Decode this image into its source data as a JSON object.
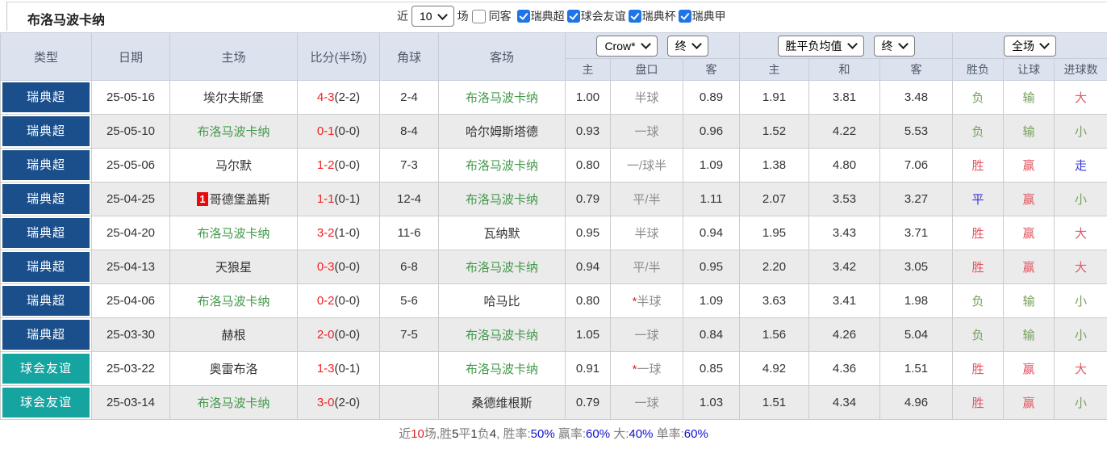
{
  "header": {
    "team_title": "布洛马波卡纳",
    "recent_label": "近",
    "recent_count": "10",
    "matches_label": "场",
    "same_away_label": "同客",
    "leagues": [
      {
        "label": "瑞典超",
        "checked": true
      },
      {
        "label": "球会友谊",
        "checked": true
      },
      {
        "label": "瑞典杯",
        "checked": true
      },
      {
        "label": "瑞典甲",
        "checked": true
      }
    ]
  },
  "table": {
    "main_headers": [
      "类型",
      "日期",
      "主场",
      "比分(半场)",
      "角球",
      "客场"
    ],
    "dropdowns": {
      "odds_company": "Crow*",
      "odds_time": "终",
      "avg_type": "胜平负均值",
      "avg_time": "终",
      "scope": "全场"
    },
    "sub_headers": [
      "主",
      "盘口",
      "客",
      "主",
      "和",
      "客",
      "胜负",
      "让球",
      "进球数"
    ],
    "league_colors": {
      "瑞典超": "#1a4f8c",
      "球会友谊": "#16a4a0"
    },
    "rows": [
      {
        "league": "瑞典超",
        "date": "25-05-16",
        "home": "埃尔夫斯堡",
        "home_badge": "",
        "home_is_target": false,
        "score": "4-3",
        "half": "(2-2)",
        "corner": "2-4",
        "away": "布洛马波卡纳",
        "away_is_target": true,
        "odds_home": "1.00",
        "handicap_star": "",
        "handicap": "半球",
        "odds_away": "0.89",
        "avg_home": "1.91",
        "avg_draw": "3.81",
        "avg_away": "3.48",
        "result": "负",
        "result_color": "green",
        "handicap_result": "输",
        "handicap_result_color": "green",
        "goals": "大",
        "goals_color": "red"
      },
      {
        "league": "瑞典超",
        "date": "25-05-10",
        "home": "布洛马波卡纳",
        "home_badge": "",
        "home_is_target": true,
        "score": "0-1",
        "half": "(0-0)",
        "corner": "8-4",
        "away": "哈尔姆斯塔德",
        "away_is_target": false,
        "odds_home": "0.93",
        "handicap_star": "",
        "handicap": "一球",
        "odds_away": "0.96",
        "avg_home": "1.52",
        "avg_draw": "4.22",
        "avg_away": "5.53",
        "result": "负",
        "result_color": "green",
        "handicap_result": "输",
        "handicap_result_color": "green",
        "goals": "小",
        "goals_color": "green"
      },
      {
        "league": "瑞典超",
        "date": "25-05-06",
        "home": "马尔默",
        "home_badge": "",
        "home_is_target": false,
        "score": "1-2",
        "half": "(0-0)",
        "corner": "7-3",
        "away": "布洛马波卡纳",
        "away_is_target": true,
        "odds_home": "0.80",
        "handicap_star": "",
        "handicap": "一/球半",
        "odds_away": "1.09",
        "avg_home": "1.38",
        "avg_draw": "4.80",
        "avg_away": "7.06",
        "result": "胜",
        "result_color": "red",
        "handicap_result": "赢",
        "handicap_result_color": "red",
        "goals": "走",
        "goals_color": "blue"
      },
      {
        "league": "瑞典超",
        "date": "25-04-25",
        "home": "哥德堡盖斯",
        "home_badge": "1",
        "home_is_target": false,
        "score": "1-1",
        "half": "(0-1)",
        "corner": "12-4",
        "away": "布洛马波卡纳",
        "away_is_target": true,
        "odds_home": "0.79",
        "handicap_star": "",
        "handicap": "平/半",
        "odds_away": "1.11",
        "avg_home": "2.07",
        "avg_draw": "3.53",
        "avg_away": "3.27",
        "result": "平",
        "result_color": "blue",
        "handicap_result": "赢",
        "handicap_result_color": "red",
        "goals": "小",
        "goals_color": "green"
      },
      {
        "league": "瑞典超",
        "date": "25-04-20",
        "home": "布洛马波卡纳",
        "home_badge": "",
        "home_is_target": true,
        "score": "3-2",
        "half": "(1-0)",
        "corner": "11-6",
        "away": "瓦纳默",
        "away_is_target": false,
        "odds_home": "0.95",
        "handicap_star": "",
        "handicap": "半球",
        "odds_away": "0.94",
        "avg_home": "1.95",
        "avg_draw": "3.43",
        "avg_away": "3.71",
        "result": "胜",
        "result_color": "red",
        "handicap_result": "赢",
        "handicap_result_color": "red",
        "goals": "大",
        "goals_color": "red"
      },
      {
        "league": "瑞典超",
        "date": "25-04-13",
        "home": "天狼星",
        "home_badge": "",
        "home_is_target": false,
        "score": "0-3",
        "half": "(0-0)",
        "corner": "6-8",
        "away": "布洛马波卡纳",
        "away_is_target": true,
        "odds_home": "0.94",
        "handicap_star": "",
        "handicap": "平/半",
        "odds_away": "0.95",
        "avg_home": "2.20",
        "avg_draw": "3.42",
        "avg_away": "3.05",
        "result": "胜",
        "result_color": "red",
        "handicap_result": "赢",
        "handicap_result_color": "red",
        "goals": "大",
        "goals_color": "red"
      },
      {
        "league": "瑞典超",
        "date": "25-04-06",
        "home": "布洛马波卡纳",
        "home_badge": "",
        "home_is_target": true,
        "score": "0-2",
        "half": "(0-0)",
        "corner": "5-6",
        "away": "哈马比",
        "away_is_target": false,
        "odds_home": "0.80",
        "handicap_star": "*",
        "handicap": "半球",
        "odds_away": "1.09",
        "avg_home": "3.63",
        "avg_draw": "3.41",
        "avg_away": "1.98",
        "result": "负",
        "result_color": "green",
        "handicap_result": "输",
        "handicap_result_color": "green",
        "goals": "小",
        "goals_color": "green"
      },
      {
        "league": "瑞典超",
        "date": "25-03-30",
        "home": "赫根",
        "home_badge": "",
        "home_is_target": false,
        "score": "2-0",
        "half": "(0-0)",
        "corner": "7-5",
        "away": "布洛马波卡纳",
        "away_is_target": true,
        "odds_home": "1.05",
        "handicap_star": "",
        "handicap": "一球",
        "odds_away": "0.84",
        "avg_home": "1.56",
        "avg_draw": "4.26",
        "avg_away": "5.04",
        "result": "负",
        "result_color": "green",
        "handicap_result": "输",
        "handicap_result_color": "green",
        "goals": "小",
        "goals_color": "green"
      },
      {
        "league": "球会友谊",
        "date": "25-03-22",
        "home": "奥雷布洛",
        "home_badge": "",
        "home_is_target": false,
        "score": "1-3",
        "half": "(0-1)",
        "corner": "",
        "away": "布洛马波卡纳",
        "away_is_target": true,
        "odds_home": "0.91",
        "handicap_star": "*",
        "handicap": "一球",
        "odds_away": "0.85",
        "avg_home": "4.92",
        "avg_draw": "4.36",
        "avg_away": "1.51",
        "result": "胜",
        "result_color": "red",
        "handicap_result": "赢",
        "handicap_result_color": "red",
        "goals": "大",
        "goals_color": "red"
      },
      {
        "league": "球会友谊",
        "date": "25-03-14",
        "home": "布洛马波卡纳",
        "home_badge": "",
        "home_is_target": true,
        "score": "3-0",
        "half": "(2-0)",
        "corner": "",
        "away": "桑德维根斯",
        "away_is_target": false,
        "odds_home": "0.79",
        "handicap_star": "",
        "handicap": "一球",
        "odds_away": "1.03",
        "avg_home": "1.51",
        "avg_draw": "4.34",
        "avg_away": "4.96",
        "result": "胜",
        "result_color": "red",
        "handicap_result": "赢",
        "handicap_result_color": "red",
        "goals": "小",
        "goals_color": "green"
      }
    ]
  },
  "footer": {
    "parts": [
      {
        "text": "近",
        "color": "gray"
      },
      {
        "text": "10",
        "color": "red"
      },
      {
        "text": "场,胜",
        "color": "gray"
      },
      {
        "text": "5",
        "color": "dark"
      },
      {
        "text": "平",
        "color": "gray"
      },
      {
        "text": "1",
        "color": "dark"
      },
      {
        "text": "负",
        "color": "gray"
      },
      {
        "text": "4",
        "color": "dark"
      },
      {
        "text": ", 胜率:",
        "color": "gray"
      },
      {
        "text": "50%",
        "color": "blue"
      },
      {
        "text": " 赢率:",
        "color": "gray"
      },
      {
        "text": "60%",
        "color": "blue"
      },
      {
        "text": " 大:",
        "color": "gray"
      },
      {
        "text": "40%",
        "color": "blue"
      },
      {
        "text": " 单率:",
        "color": "gray"
      },
      {
        "text": "60%",
        "color": "blue"
      }
    ]
  },
  "colors": {
    "league_super": "#1a4f8c",
    "league_friendly": "#16a4a0",
    "target_team_green": "#42994a",
    "score_red": "#f02222",
    "result_red": "#e25863",
    "result_green": "#75a05c",
    "result_blue": "#3939d9",
    "header_bg": "#dde3ee",
    "handicap_col_bg": "#faf3eb",
    "avg_col_bg": "#e8f3f8",
    "stripe_gray": "#ebebeb",
    "checkbox_blue": "#1e74e8",
    "footer_blue": "#0f0fd0",
    "footer_red": "#e02222"
  }
}
